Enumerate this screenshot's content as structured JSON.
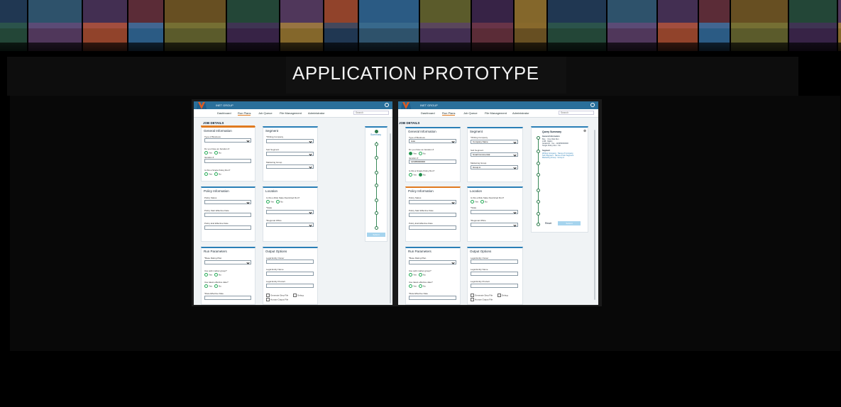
{
  "page": {
    "title": "APPLICATION PROTOTYPE"
  },
  "app": {
    "brand": "INET GROUP",
    "nav": [
      "Dashboard",
      "Run Plans",
      "Job Queue",
      "File Management",
      "Administrator"
    ],
    "search_placeholder": "Search",
    "page_heading": "JOB DETAILS"
  },
  "form": {
    "general": {
      "title": "General Information",
      "type_of_business": "Type of Business",
      "iteration_q": "Do you have an Iteration #",
      "iteration": "Iteration #",
      "single_policy_q": "Is this a Single Policy Run?",
      "yes": "Yes",
      "no": "No"
    },
    "segment": {
      "title": "Segment",
      "writing_company": "*Writing Company",
      "sub_segment": "Sub Segment",
      "marketing_group": "Marketing Group"
    },
    "policy": {
      "title": "Policy Information",
      "status": "Policy Status",
      "start": "Policy Start Effective Date",
      "end": "Policy End Effective Date"
    },
    "location": {
      "title": "Location",
      "restricted_q": "Is this a Risk State Restricted Run?",
      "state": "*State",
      "regional_office": "*Regional Office"
    },
    "run": {
      "title": "Run Parameters",
      "base_rating": "*Base Rating Plan",
      "split_q": "Use split market group?",
      "latest_q": "Use latest effective date?",
      "rate_date": "*Rate Effective Date"
    },
    "output": {
      "title": "Output Options",
      "entity_owner": "Legal Entity Owner",
      "entity_name": "Legal Entity Name",
      "entity_product": "Legal Entity Product",
      "gen_step": "Generate Step File",
      "debug": "Debug",
      "human_output": "Human Output File"
    }
  },
  "summary_a": {
    "title": "Summary",
    "submit": "Submit"
  },
  "prefilled": {
    "business": "Auto",
    "iteration": "123456000000",
    "writing_company": "Company Name",
    "sub_segment": "Small Commercial",
    "marketing_group": "Group A"
  },
  "query_summary": {
    "title": "Query Summary",
    "general_title": "General Information",
    "general_lines": [
      "Bus. : One Risk Run",
      "LOB : Matrix",
      "Iteration# : Yes - 123456000000",
      "Single Policy Run : No"
    ],
    "segment_title": "Segment",
    "segment_lines": [
      "Writing Company : Name of Company",
      "Sub Segment : Name of Sub Segment",
      "Marketing Group : Group A"
    ],
    "reset": "Reset",
    "submit": "Submit"
  }
}
